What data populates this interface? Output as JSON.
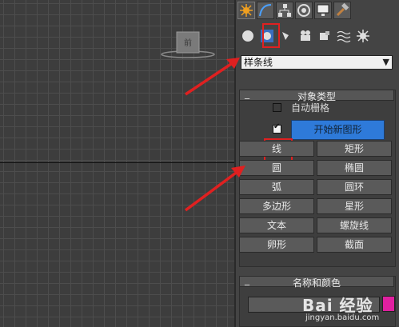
{
  "viewport": {
    "gizmo_label": "前"
  },
  "command_panel": {
    "tabs": [
      {
        "icon": "create-star-icon",
        "active": true
      },
      {
        "icon": "modify-curve-icon",
        "active": false
      },
      {
        "icon": "hierarchy-icon",
        "active": false
      },
      {
        "icon": "motion-icon",
        "active": false
      },
      {
        "icon": "display-monitor-icon",
        "active": false
      },
      {
        "icon": "utilities-hammer-icon",
        "active": false
      }
    ],
    "subcategories": [
      "geometry-sphere-icon",
      "shapes-icon",
      "lights-icon",
      "cameras-icon",
      "helpers-icon",
      "spacewarps-icon",
      "systems-icon"
    ],
    "category_dropdown": {
      "value": "样条线"
    },
    "object_type_rollout": {
      "title": "对象类型",
      "autogrid_label": "自动栅格",
      "start_new_shape_label": "开始新图形",
      "buttons": [
        [
          "线",
          "矩形"
        ],
        [
          "圆",
          "椭圆"
        ],
        [
          "弧",
          "圆环"
        ],
        [
          "多边形",
          "星形"
        ],
        [
          "文本",
          "螺旋线"
        ],
        [
          "卵形",
          "截面"
        ]
      ]
    },
    "name_color_rollout": {
      "title": "名称和颜色",
      "swatch_color": "#e020a0"
    }
  },
  "colors": {
    "highlight": "#e02020",
    "accent_blue": "#2e7ad9"
  },
  "watermark": {
    "brand": "Bai 经验",
    "url": "jingyan.baidu.com"
  }
}
